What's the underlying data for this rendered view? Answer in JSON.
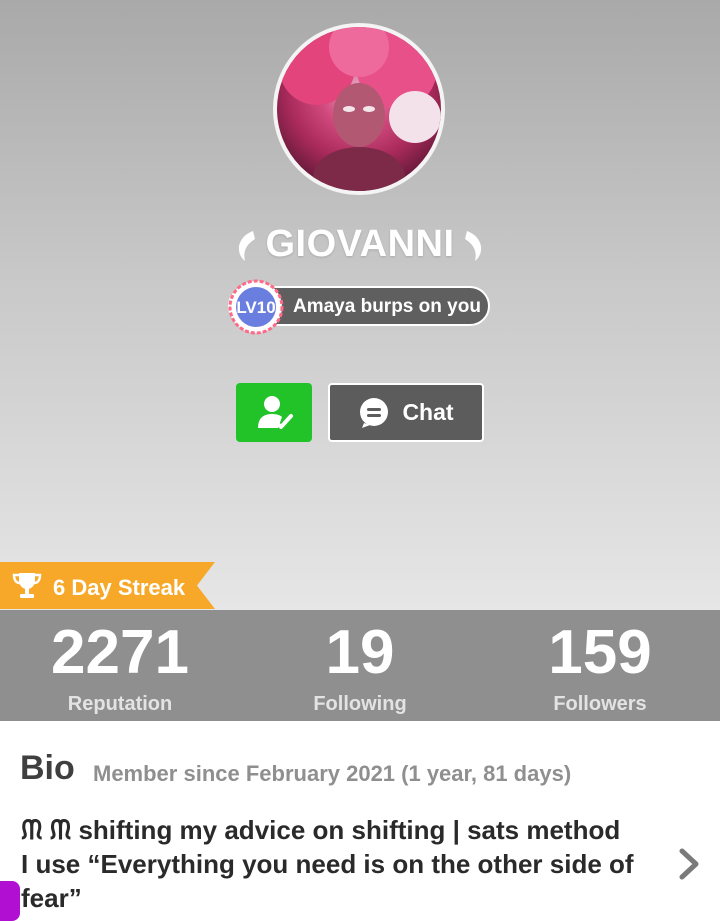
{
  "profile": {
    "username": "GIOVANNI",
    "level_badge": "LV10",
    "level_title": "Amaya burps on you"
  },
  "actions": {
    "follow_icon": "user-check-icon",
    "chat_label": "Chat",
    "chat_icon": "chat-bubble-icon"
  },
  "streak": {
    "label": "6 Day Streak",
    "icon": "trophy-icon"
  },
  "stats": [
    {
      "value": "2271",
      "label": "Reputation"
    },
    {
      "value": "19",
      "label": "Following"
    },
    {
      "value": "159",
      "label": "Followers"
    }
  ],
  "bio": {
    "title": "Bio",
    "member_since": "Member since February 2021 (1 year, 81 days)",
    "text": "ᙏ ᙏ shifting my advice on shifting | sats method\nI use “Everything you need is on the other side of\nfear”"
  },
  "colors": {
    "follow_green": "#21c329",
    "chat_gray": "#5c5c5c",
    "streak_orange": "#f7a829",
    "stats_bar": "#8f8f8f"
  }
}
